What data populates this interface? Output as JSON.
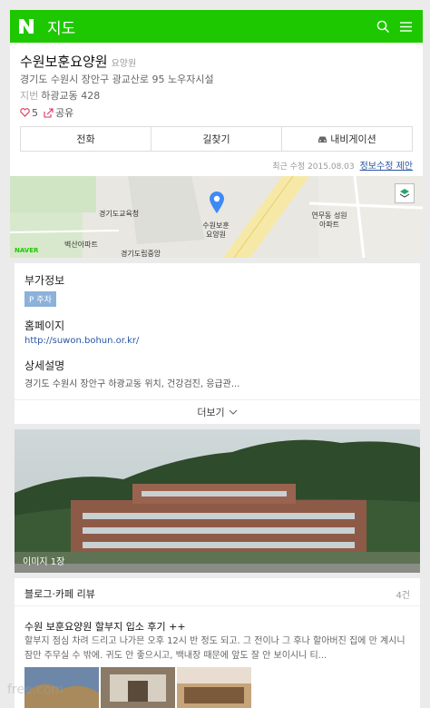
{
  "header": {
    "logo": "N",
    "title": "지도",
    "icons": [
      "search-icon",
      "menu-icon"
    ]
  },
  "place": {
    "name": "수원보훈요양원",
    "category": "요양원",
    "address": "경기도 수원시 장안구 광교산로 95 노우자시설",
    "jibun_label": "지번",
    "jibun": "하광교동 428",
    "likes": "5",
    "share_label": "공유",
    "buttons": [
      "전화",
      "길찾기",
      "내비게이션"
    ],
    "updated": "최근 수정 2015.08.03",
    "edit_link": "정보수정 제안"
  },
  "map": {
    "labels": [
      "경기도교육청",
      "수원보훈 요양원",
      "연무동 성원아파트",
      "벽산아파트",
      "경기도립중앙",
      "NAVER"
    ]
  },
  "extra": {
    "title": "부가정보",
    "parking": "P 주차",
    "homepage_title": "홈페이지",
    "homepage_url": "http://suwon.bohun.or.kr/",
    "desc_title": "상세설명",
    "desc_text": "경기도 수원시 장안구 하광교동 위치, 건강검진, 응급관...",
    "more_label": "더보기"
  },
  "photo": {
    "count_label": "이미지 1장"
  },
  "blog": {
    "title": "블로그·카페 리뷰",
    "count": "4건",
    "post_title": "수원 보훈요양원 할부지 입소 후기 ++",
    "post_excerpt": "할부지 점심 차려 드리고 나가믄 오후 12시 반 정도 되고. 그 전이나 그 후나 할아버진 집에 만 계시니 잠만 주무실 수 밖에. 귀도 안 좋으시고, 백내장 때문에 앞도 잘 안 보이시니 티..."
  },
  "watermark": "free.com"
}
